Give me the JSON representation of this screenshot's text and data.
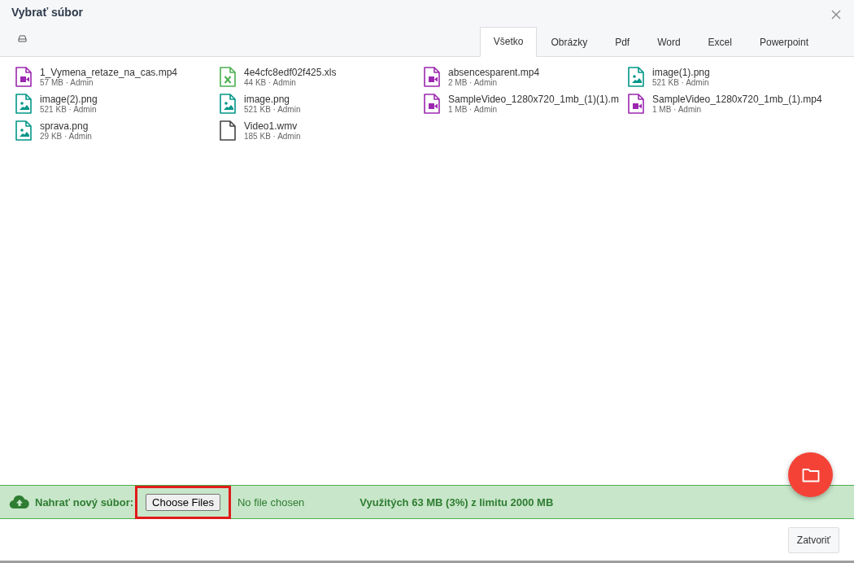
{
  "dialog": {
    "title": "Vybrať súbor"
  },
  "tabs": [
    {
      "label": "Všetko",
      "selected": true
    },
    {
      "label": "Obrázky",
      "selected": false
    },
    {
      "label": "Pdf",
      "selected": false
    },
    {
      "label": "Word",
      "selected": false
    },
    {
      "label": "Excel",
      "selected": false
    },
    {
      "label": "Powerpoint",
      "selected": false
    }
  ],
  "files": [
    {
      "kind": "video",
      "name": "1_Vymena_retaze_na_cas.mp4",
      "meta": "57 MB · Admin"
    },
    {
      "kind": "excel",
      "name": "4e4cfc8edf02f425.xls",
      "meta": "44 KB · Admin"
    },
    {
      "kind": "video",
      "name": "absencesparent.mp4",
      "meta": "2 MB · Admin"
    },
    {
      "kind": "image",
      "name": "image(1).png",
      "meta": "521 KB · Admin"
    },
    {
      "kind": "image",
      "name": "image(2).png",
      "meta": "521 KB · Admin"
    },
    {
      "kind": "image",
      "name": "image.png",
      "meta": "521 KB · Admin"
    },
    {
      "kind": "video",
      "name": "SampleVideo_1280x720_1mb_(1)(1).m",
      "meta": "1 MB · Admin"
    },
    {
      "kind": "video",
      "name": "SampleVideo_1280x720_1mb_(1).mp4",
      "meta": "1 MB · Admin"
    },
    {
      "kind": "image",
      "name": "sprava.png",
      "meta": "29 KB · Admin"
    },
    {
      "kind": "generic",
      "name": "Video1.wmv",
      "meta": "185 KB · Admin"
    }
  ],
  "upload": {
    "label": "Nahrať nový súbor:",
    "button": "Choose Files",
    "status": "No file chosen",
    "usage": "Využitých 63 MB (3%) z limitu 2000 MB"
  },
  "footer": {
    "close_button": "Zatvoriť"
  }
}
